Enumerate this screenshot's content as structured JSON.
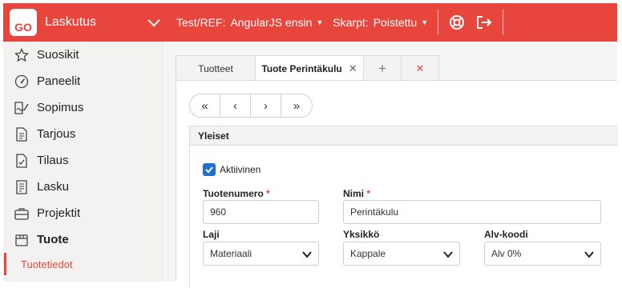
{
  "topbar": {
    "logo_text": "GO",
    "app_title": "Laskutus",
    "env_label": "Test/REF:",
    "env_value": "AngularJS ensin",
    "schema_label": "Skarpt:",
    "schema_value": "Poistettu",
    "accent": "#e8453c"
  },
  "sidebar": {
    "items": [
      {
        "label": "Suosikit",
        "icon": "star-icon"
      },
      {
        "label": "Paneelit",
        "icon": "gauge-icon"
      },
      {
        "label": "Sopimus",
        "icon": "contract-icon"
      },
      {
        "label": "Tarjous",
        "icon": "document-icon"
      },
      {
        "label": "Tilaus",
        "icon": "order-icon"
      },
      {
        "label": "Lasku",
        "icon": "invoice-icon"
      },
      {
        "label": "Projektit",
        "icon": "briefcase-icon"
      },
      {
        "label": "Tuote",
        "icon": "box-icon"
      }
    ],
    "sub_item": "Tuotetiedot"
  },
  "tabs": [
    {
      "label": "Tuotteet"
    },
    {
      "label": "Tuote Perintäkulu"
    }
  ],
  "form": {
    "section_title": "Yleiset",
    "active_label": "Aktiivinen",
    "active_checked": true,
    "product_number_label": "Tuotenumero",
    "product_number_value": "960",
    "name_label": "Nimi",
    "name_value": "Perintäkulu",
    "type_label": "Laji",
    "type_value": "Materiaali",
    "unit_label": "Yksikkö",
    "unit_value": "Kappale",
    "vat_label": "Alv-koodi",
    "vat_value": "Alv 0%",
    "required_mark": "*"
  }
}
